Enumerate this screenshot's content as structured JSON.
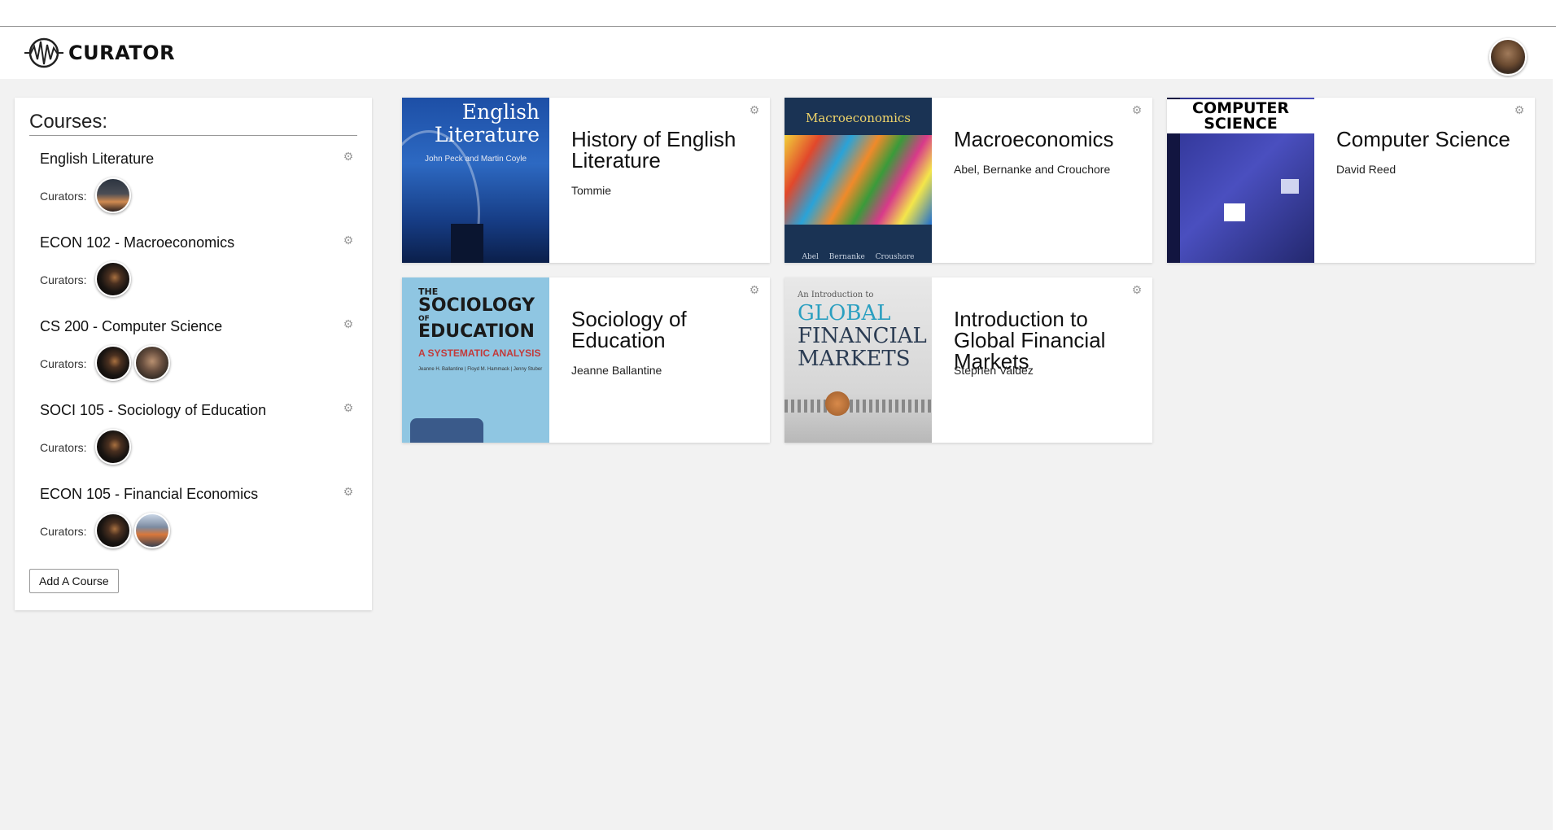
{
  "app": {
    "brand": "CURATOR"
  },
  "sidebar": {
    "title": "Courses:",
    "curators_label": "Curators:",
    "add_course_label": "Add A Course",
    "courses": [
      {
        "name": "English Literature",
        "curators": [
          "av-sunset"
        ]
      },
      {
        "name": "ECON 102 - Macroeconomics",
        "curators": [
          "av-dark"
        ]
      },
      {
        "name": "CS 200 - Computer Science",
        "curators": [
          "av-dark",
          "av-beard"
        ]
      },
      {
        "name": "SOCI 105 - Sociology of Education",
        "curators": [
          "av-dark"
        ]
      },
      {
        "name": "ECON 105 - Financial Economics",
        "curators": [
          "av-dark",
          "av-car"
        ]
      }
    ]
  },
  "cards": [
    {
      "title": "History of English Literature",
      "author": "Tommie",
      "cover": {
        "title": "English Literature",
        "title_line1": "English",
        "title_line2": "Literature",
        "subtitle": "John Peck and Martin Coyle"
      }
    },
    {
      "title": "Macroeconomics",
      "author": "Abel, Bernanke and Crouchore",
      "cover": {
        "title": "Macroeconomics",
        "authors": "Abel Bernanke Croushore"
      }
    },
    {
      "title": "Computer Science",
      "author": "David Reed",
      "cover": {
        "title_line1": "COMPUTER",
        "title_line2": "SCIENCE"
      }
    },
    {
      "title": "Sociology of Education",
      "author": "Jeanne Ballantine",
      "cover": {
        "title_line1": "THE",
        "title_line2": "SOCIOLOGY",
        "title_line3": "OF",
        "title_line4": "EDUCATION",
        "subtitle": "A SYSTEMATIC ANALYSIS",
        "authors": "Jeanne H. Ballantine | Floyd M. Hammack | Jenny Stuber"
      }
    },
    {
      "title": "Introduction to Global Financial Markets",
      "author": "Stephen Valdez",
      "cover": {
        "kicker": "An Introduction to",
        "title_line1": "GLOBAL",
        "title_line2": "FINANCIAL",
        "title_line3": "MARKETS"
      }
    }
  ],
  "icons": {
    "gear": "gear-icon",
    "logo": "soundwave-logo-icon"
  },
  "colors": {
    "page_bg": "#f2f2f2",
    "panel_bg": "#ffffff",
    "gear": "#999999"
  }
}
